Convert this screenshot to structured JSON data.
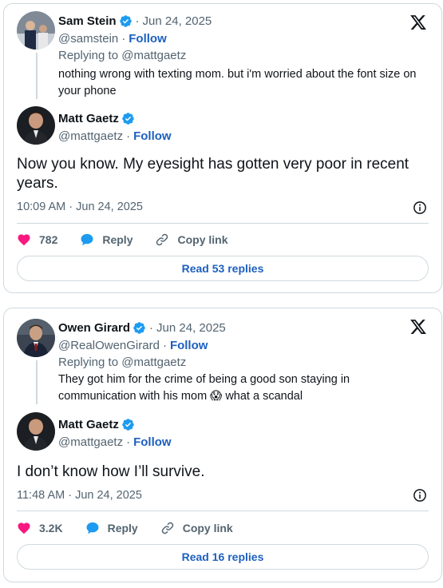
{
  "cards": [
    {
      "reply": {
        "name": "Sam Stein",
        "date": "Jun 24, 2025",
        "handle": "@samstein",
        "follow": "Follow",
        "replying_prefix": "Replying to",
        "replying_to": "@mattgaetz",
        "text": "nothing wrong with texting mom. but i'm worried about the font size on your phone"
      },
      "main": {
        "name": "Matt Gaetz",
        "handle": "@mattgaetz",
        "follow": "Follow",
        "text": "Now you know. My eyesight has gotten very poor in recent years.",
        "timestamp": "10:09 AM · Jun 24, 2025"
      },
      "actions": {
        "likes": "782",
        "reply": "Reply",
        "copy_link": "Copy link"
      },
      "read_replies": "Read 53 replies"
    },
    {
      "reply": {
        "name": "Owen Girard",
        "date": "Jun 24, 2025",
        "handle": "@RealOwenGirard",
        "follow": "Follow",
        "replying_prefix": "Replying to",
        "replying_to": "@mattgaetz",
        "text": "They got him for the crime of being a good son staying in communication with his mom 😱 what a scandal"
      },
      "main": {
        "name": "Matt Gaetz",
        "handle": "@mattgaetz",
        "follow": "Follow",
        "text": "I don’t know how I’ll survive.",
        "timestamp": "11:48 AM · Jun 24, 2025"
      },
      "actions": {
        "likes": "3.2K",
        "reply": "Reply",
        "copy_link": "Copy link"
      },
      "read_replies": "Read 16 replies"
    }
  ],
  "colors": {
    "accent": "#1d60c0",
    "like": "#f91880",
    "reply_icon": "#1d9bf0",
    "verified": "#1d9bf0",
    "muted": "#536471",
    "border": "#cfd9de"
  },
  "icons": [
    "x-logo-icon",
    "verified-badge-icon",
    "info-icon",
    "heart-icon",
    "reply-bubble-icon",
    "link-icon"
  ]
}
